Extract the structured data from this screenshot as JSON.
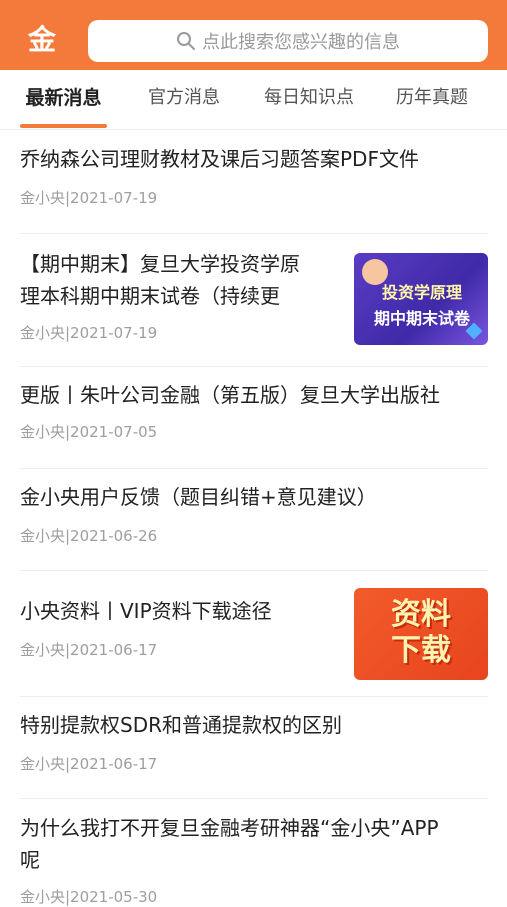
{
  "header": {
    "logo_text": "金",
    "search_placeholder": "点此搜索您感兴趣的信息",
    "colors": {
      "brand": "#f47a3c"
    }
  },
  "tabs": [
    {
      "label": "最新消息"
    },
    {
      "label": "官方消息"
    },
    {
      "label": "每日知识点"
    },
    {
      "label": "历年真题"
    }
  ],
  "articles": [
    {
      "title": "乔纳森公司理财教材及课后习题答案PDF文件",
      "meta": "金小央|2021-07-19"
    },
    {
      "title_line1": "【期中期末】复旦大学投资学原",
      "title_line2": "理本科期中期末试卷（持续更",
      "meta": "金小央|2021-07-19",
      "thumb": {
        "line1": "投资学原理",
        "line2": "期中期末试卷"
      }
    },
    {
      "title": "更版丨朱叶公司金融（第五版）复旦大学出版社",
      "meta": "金小央|2021-07-05"
    },
    {
      "title": "金小央用户反馈（题目纠错+意见建议）",
      "meta": "金小央|2021-06-26"
    },
    {
      "title": "小央资料丨VIP资料下载途径",
      "meta": "金小央|2021-06-17",
      "thumb": {
        "line1": "资料",
        "line2": "下载"
      }
    },
    {
      "title": "特别提款权SDR和普通提款权的区别",
      "meta": "金小央|2021-06-17"
    },
    {
      "title_line1": "为什么我打不开复旦金融考研神器“金小央”APP",
      "title_line2": "呢",
      "meta": "金小央|2021-05-30"
    }
  ]
}
